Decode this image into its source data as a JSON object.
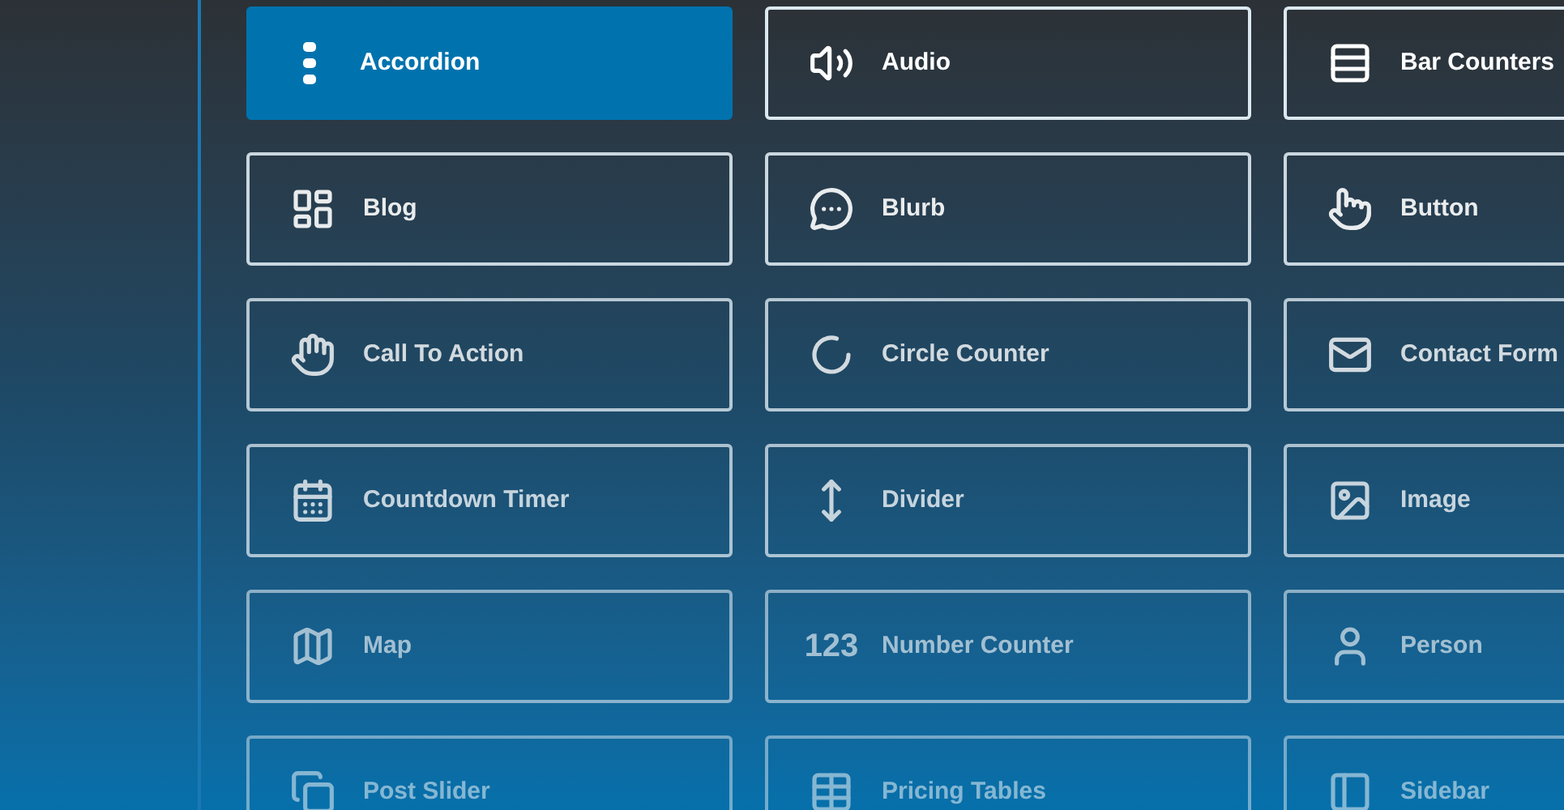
{
  "modules": [
    {
      "label": "Accordion",
      "selected": true
    },
    {
      "label": "Audio",
      "selected": false
    },
    {
      "label": "Bar Counters",
      "selected": false
    },
    {
      "label": "Blog",
      "selected": false
    },
    {
      "label": "Blurb",
      "selected": false
    },
    {
      "label": "Button",
      "selected": false
    },
    {
      "label": "Call To Action",
      "selected": false
    },
    {
      "label": "Circle Counter",
      "selected": false
    },
    {
      "label": "Contact Form",
      "selected": false
    },
    {
      "label": "Countdown Timer",
      "selected": false
    },
    {
      "label": "Divider",
      "selected": false
    },
    {
      "label": "Image",
      "selected": false
    },
    {
      "label": "Map",
      "selected": false
    },
    {
      "label": "Number Counter",
      "selected": false,
      "icon_text": "123"
    },
    {
      "label": "Person",
      "selected": false
    },
    {
      "label": "Post Slider",
      "selected": false
    },
    {
      "label": "Pricing Tables",
      "selected": false
    },
    {
      "label": "Sidebar",
      "selected": false
    }
  ]
}
